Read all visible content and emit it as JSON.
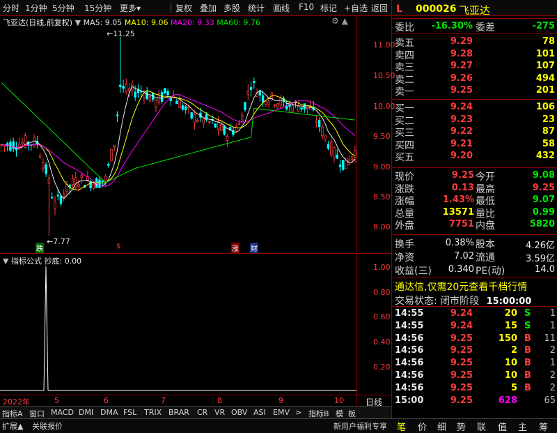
{
  "toolbar": {
    "items": [
      "分时",
      "1分钟",
      "5分钟",
      "15分钟",
      "更多",
      "复权",
      "叠加",
      "多股",
      "统计",
      "画线",
      "F10",
      "标记",
      "+自选",
      "返回"
    ]
  },
  "chart": {
    "title": "飞亚达(日线,前复权)",
    "ma5": "MA5: 9.05",
    "ma10": "MA10: 9.06",
    "ma20": "MA20: 9.33",
    "ma60": "MA60: 9.76",
    "high_label": "11.25",
    "low_label": "7.77",
    "y_ticks": [
      "11.00",
      "10.50",
      "10.00",
      "9.50",
      "9.00",
      "8.50",
      "8.00"
    ],
    "markers": [
      {
        "text": "跌",
        "color": "#00a000"
      },
      {
        "text": "$",
        "color": "#ff3b3b"
      },
      {
        "text": "涨",
        "color": "#a00000"
      },
      {
        "text": "财",
        "color": "#2255ff"
      }
    ],
    "ind_title": "指标公式",
    "ind_name": "抄底:",
    "ind_value": "0.00",
    "ind_ticks": [
      "1.00",
      "0.80",
      "0.60",
      "0.40",
      "0.20"
    ],
    "x_labels": [
      "2022年",
      "5",
      "6",
      "7",
      "8",
      "9",
      "10"
    ],
    "period": "日线",
    "colors": {
      "ma5": "#e8e8e8",
      "ma10": "#ffff00",
      "ma20": "#ff00ff",
      "ma60": "#00e600",
      "up": "#ff3b3b",
      "down": "#00ffff"
    }
  },
  "bottom_tabs": [
    "指标A",
    "窗口",
    "MACD",
    "DMI",
    "DMA",
    "FSL",
    "TRIX",
    "BRAR",
    "CR",
    "VR",
    "OBV",
    "ASI",
    "EMV",
    ">",
    "指标B",
    "模",
    "板"
  ],
  "bottom2": {
    "left1": "扩展▲",
    "left2": "关联报价",
    "promo": "新用户福利专享",
    "tabs": [
      "笔",
      "价",
      "细",
      "势",
      "联",
      "值",
      "主",
      "筹"
    ]
  },
  "quote": {
    "flag": "L",
    "code": "000026",
    "name": "飞亚达",
    "wb_label": "委比",
    "wb_value": "-16.30%",
    "wc_label": "委差",
    "wc_value": "-275",
    "sell": [
      {
        "label": "卖五",
        "price": "9.29",
        "vol": "78"
      },
      {
        "label": "卖四",
        "price": "9.28",
        "vol": "101"
      },
      {
        "label": "卖三",
        "price": "9.27",
        "vol": "107"
      },
      {
        "label": "卖二",
        "price": "9.26",
        "vol": "494"
      },
      {
        "label": "卖一",
        "price": "9.25",
        "vol": "201"
      }
    ],
    "buy": [
      {
        "label": "买一",
        "price": "9.24",
        "vol": "106"
      },
      {
        "label": "买二",
        "price": "9.23",
        "vol": "23"
      },
      {
        "label": "买三",
        "price": "9.22",
        "vol": "87"
      },
      {
        "label": "买四",
        "price": "9.21",
        "vol": "58"
      },
      {
        "label": "买五",
        "price": "9.20",
        "vol": "432"
      }
    ],
    "stats": [
      {
        "l1": "现价",
        "v1": "9.25",
        "c1": "red",
        "l2": "今开",
        "v2": "9.08",
        "c2": "green"
      },
      {
        "l1": "涨跌",
        "v1": "0.13",
        "c1": "red",
        "l2": "最高",
        "v2": "9.25",
        "c2": "red"
      },
      {
        "l1": "涨幅",
        "v1": "1.43%",
        "c1": "red",
        "l2": "最低",
        "v2": "9.07",
        "c2": "green"
      },
      {
        "l1": "总量",
        "v1": "13571",
        "c1": "yellow",
        "l2": "量比",
        "v2": "0.99",
        "c2": "green"
      },
      {
        "l1": "外盘",
        "v1": "7751",
        "c1": "red",
        "l2": "内盘",
        "v2": "5820",
        "c2": "green"
      }
    ],
    "stats2": [
      {
        "l1": "换手",
        "v1": "0.38%",
        "l2": "股本",
        "v2": "4.26亿"
      },
      {
        "l1": "净资",
        "v1": "7.02",
        "l2": "流通",
        "v2": "3.59亿"
      },
      {
        "l1": "收益(三)",
        "v1": "0.340",
        "l2": "PE(动)",
        "v2": "14.0"
      }
    ],
    "ad": "通达信,仅需20元查看千档行情",
    "status_label": "交易状态:",
    "status_value": "闭市阶段",
    "status_time": "15:00:00",
    "ticks": [
      {
        "t": "14:55",
        "p": "9.24",
        "v": "20",
        "d": "S",
        "n": "1"
      },
      {
        "t": "14:55",
        "p": "9.24",
        "v": "15",
        "d": "S",
        "n": "1"
      },
      {
        "t": "14:56",
        "p": "9.25",
        "v": "150",
        "d": "B",
        "n": "11"
      },
      {
        "t": "14:56",
        "p": "9.25",
        "v": "2",
        "d": "B",
        "n": "2"
      },
      {
        "t": "14:56",
        "p": "9.25",
        "v": "10",
        "d": "B",
        "n": "1"
      },
      {
        "t": "14:56",
        "p": "9.25",
        "v": "10",
        "d": "B",
        "n": "2"
      },
      {
        "t": "14:56",
        "p": "9.25",
        "v": "5",
        "d": "B",
        "n": "2"
      },
      {
        "t": "15:00",
        "p": "9.25",
        "v": "628",
        "d": "",
        "n": "65"
      }
    ]
  }
}
